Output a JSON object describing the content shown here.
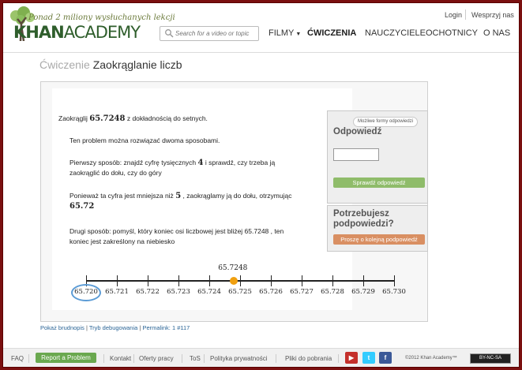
{
  "header": {
    "tagline": "Ponad 2 miliony wysłuchanych lekcji",
    "logo_bold": "KHAN",
    "logo_light": "ACADEMY",
    "search_placeholder": "Search for a video or topic",
    "login": "Login",
    "support": "Wesprzyj nas",
    "nav": [
      "FILMY",
      "ĆWICZENIA",
      "NAUCZYCIELE",
      "OCHOTNICY",
      "O NAS"
    ]
  },
  "page": {
    "title_prefix": "Ćwiczenie",
    "title": "Zaokrąglanie liczb"
  },
  "problem": {
    "q_pre": "Zaokrąglij",
    "q_num": "65.7248",
    "q_post": "z dokładnością do setnych.",
    "intro": "Ten problem można rozwiązać dwoma sposobami.",
    "first_pre": "Pierwszy sposób: znajdź cyfrę tysięcznych",
    "first_digit": "4",
    "first_post": "i sprawdź, czy trzeba ją",
    "first_line2": "zaokrąglić do dołu, czy do góry",
    "because_pre": "Ponieważ ta cyfra jest mniejsza niż",
    "because_digit": "5",
    "because_post": ", zaokrąglamy ją do dołu, otrzymując",
    "result": "65.72",
    "second_line1": "Drugi sposób: pomyśl, który koniec osi liczbowej jest bliżej 65.7248 , ten",
    "second_line2": "koniec jest zakreślony na niebiesko",
    "number_line": {
      "labels": [
        "65.720",
        "65.721",
        "65.722",
        "65.723",
        "65.724",
        "65.725",
        "65.726",
        "65.727",
        "65.728",
        "65.729",
        "65.730"
      ],
      "point_label": "65.7248",
      "point_value": 65.7248,
      "min": 65.72,
      "max": 65.73,
      "highlighted": "65.720"
    }
  },
  "answer": {
    "badge": "Możliwe formy odpowiedzi",
    "title": "Odpowiedź",
    "input_value": "",
    "check_button": "Sprawdź odpowiedź"
  },
  "hint": {
    "title_line1": "Potrzebujesz",
    "title_line2": "podpowiedzi?",
    "button": "Proszę o kolejną podpowiedź"
  },
  "links": {
    "scratchpad": "Pokaż brudnopis",
    "sep": "|",
    "debug": "Tryb debugowania",
    "permalink": "Permalink: 1 #117"
  },
  "footer": {
    "faq": "FAQ",
    "report": "Report a Problem",
    "items": [
      "Kontakt",
      "Oferty pracy",
      "ToS",
      "Polityka prywatności",
      "Pliki do pobrania"
    ],
    "copyright": "©2012 Khan Academy™",
    "license": "BY-NC-SA",
    "colors": {
      "green": "#6aa84f",
      "youtube": "#c4302b",
      "twitter": "#33ccff",
      "facebook": "#3b5998"
    }
  }
}
